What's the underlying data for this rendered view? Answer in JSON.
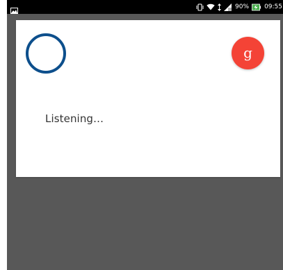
{
  "status_bar": {
    "battery_percent": "90%",
    "time": "09:55",
    "left_icon": "gallery-icon",
    "right_icons": [
      "vibrate-icon",
      "wifi-icon",
      "data-transfer-icon",
      "signal-icon",
      "battery-charging-icon"
    ]
  },
  "dialog": {
    "status_text": "Listening…",
    "google_button_label": "g",
    "colors": {
      "mic_ring": "#0d4f8c",
      "google_button": "#f44336"
    }
  }
}
